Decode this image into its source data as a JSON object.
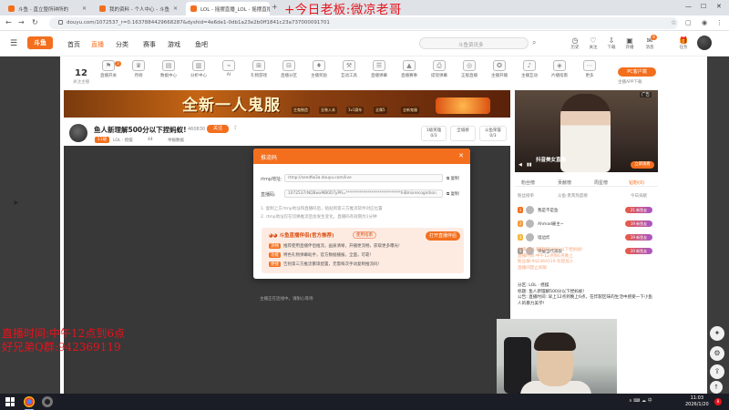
{
  "browser": {
    "tabs": [
      {
        "title": "斗鱼 - 直立暨所钟所的"
      },
      {
        "title": "我的资料 - 个人中心 - 斗鱼"
      },
      {
        "title": "LOL - 摇摆直播_LOL - 摇摆直播"
      }
    ],
    "url": "douyu.com/1072537_r=0.1637884429668287&dyshid=4e6de1-0db1a23e2b0ff1841c23a737000091701",
    "window_controls": {
      "minimize": "—",
      "maximize": "☐",
      "close": "✕"
    }
  },
  "overlay_title": "+今日老板:微凉老哥",
  "douyu_header": {
    "logo": "斗鱼",
    "nav": [
      "首页",
      "直播",
      "分类",
      "赛事",
      "游戏",
      "鱼吧"
    ],
    "search_placeholder": "斗鱼资讯多",
    "icons": [
      {
        "name": "history",
        "label": "历史"
      },
      {
        "name": "follow",
        "label": "关注"
      },
      {
        "name": "download",
        "label": "下载"
      },
      {
        "name": "broadcast",
        "label": "开播"
      },
      {
        "name": "message",
        "label": "消息"
      },
      {
        "name": "gift",
        "label": "任务"
      }
    ],
    "message_badge": "8"
  },
  "category_bar": {
    "follow_count": "12",
    "follow_label": "关注主播",
    "badge": "2",
    "items": [
      "直播开关",
      "月榜",
      "数据中心",
      "分析中心",
      "AI",
      "礼物游戏",
      "直播分区",
      "主播奖励",
      "互动工具",
      "直播弹幕",
      "直播赛事",
      "提现弹幕",
      "正版直播",
      "主播开播",
      "主播互动",
      "片播指南",
      "更多"
    ],
    "pc_button": "PC客户端",
    "app_label": "主播APP下载"
  },
  "banner": {
    "title": "全新一人鬼服",
    "chips": [
      "主鬼制造",
      "全装入本",
      "1v1赛车",
      "全属5",
      "全新鬼服"
    ]
  },
  "room": {
    "title": "鱼人新理解500分以下捏蚂蚁!",
    "room_id": "460830",
    "follow_label": "关注",
    "level": "11级",
    "category": "LOL · 摇摆",
    "viewers": "44",
    "report_label": "举报数据",
    "rank_boxes": [
      "1级英雄\n0/3",
      "全城榜",
      "斗鱼荣誉\n0/3"
    ]
  },
  "video": {
    "message": "主播正在连线中，请耐心等待"
  },
  "dialog": {
    "title": "推流码",
    "rtmp_label": "rtmp地址:",
    "rtmp_value": "rtmp://sendfw3a.douyu.com/live",
    "key_label": "直播码:",
    "key_value": "1072537rNQBwxMB0D7yPR=****************************hiBmixrecognition",
    "copy_label": "复制",
    "notes": [
      "1. 复制上方rtmp地址和直播码后，粘贴到第三方推流软件对应位置",
      "2. rtmp地址仅在切换推流后会发生变化，直播码有效期为1分钟"
    ],
    "promo": {
      "title": "斗鱼直播伴侣(官方推荐)",
      "tag": "使用指南",
      "button": "打开直播伴侣",
      "lines": [
        {
          "tag": "流畅",
          "text": "推荐使用直播伴侣推流，画质清晰，开播更流畅，获取更多曝光!"
        },
        {
          "tag": "功能",
          "text": "特色礼物弹幕助手，官方数据播报，全面，可靠!"
        },
        {
          "tag": "便捷",
          "text": "告别第三方推流繁琐配置，无需每次手动复制推流码!"
        }
      ]
    }
  },
  "preview": {
    "ad_label": "广告",
    "caption": "抖音美女直播",
    "button": "立即观看",
    "controls": [
      "◀",
      "▮▮"
    ]
  },
  "right_panel": {
    "tabs": [
      "粉丝榜",
      "贡献榜",
      "周星榜",
      "钻粉(0)"
    ],
    "sub": [
      "粉丝榜单",
      "斗鱼·贵宾热度榜",
      "今日贡献"
    ],
    "ranks": [
      {
        "num": "1",
        "name": "我是不是鱼",
        "badge": "21 新鱼友",
        "color": "#f36f1e"
      },
      {
        "num": "2",
        "name": "Ahmad雇主~",
        "badge": "19 新鱼友",
        "color": "#f59a3c"
      },
      {
        "num": "3",
        "name": "墙边炸",
        "badge": "19 新鱼友",
        "color": "#f5b83c"
      },
      {
        "num": "4",
        "name": "突破当代高段",
        "badge": "20 新鱼友",
        "color": "#999999"
      }
    ],
    "chat_faded": [
      "主播:鱼人新理解500分以下捏蚂蚁!",
      "直播时间:中午12点到6点晚上",
      "粉丝群:942369119 欢迎加入",
      "直播间禁止刷屏"
    ],
    "chat": [
      "分区: LOL · 摇摆",
      "标题: 鱼人新理解500分以下捏蚂蚁!",
      "公告: 直播时间: 早上12点到晚上6点，在炸裂区味的生活中感受一下小鱼人的暴力美学!"
    ]
  },
  "overlays": {
    "time": "直播时间:中午12点到6点",
    "qq": "好兄弟Q群:942369119"
  },
  "taskbar": {
    "tray": "∧ ⌨ ☁ 中",
    "time": "11:03",
    "date": "2026/1/20",
    "notifications": "8"
  }
}
